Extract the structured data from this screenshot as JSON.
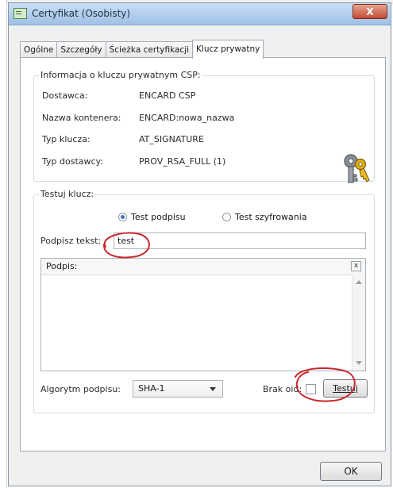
{
  "window": {
    "title": "Certyfikat (Osobisty)",
    "close_glyph": "X"
  },
  "tabs": [
    {
      "label": "Ogólne",
      "active": false
    },
    {
      "label": "Szczegóły",
      "active": false
    },
    {
      "label": "Ścieżka certyfikacji",
      "active": false
    },
    {
      "label": "Klucz prywatny",
      "active": true
    }
  ],
  "csp_info": {
    "title": "Informacja o kluczu prywatnym CSP:",
    "rows": [
      {
        "label": "Dostawca:",
        "value": "ENCARD CSP"
      },
      {
        "label": "Nazwa kontenera:",
        "value": "ENCARD:nowa_nazwa"
      },
      {
        "label": "Typ klucza:",
        "value": "AT_SIGNATURE"
      },
      {
        "label": "Typ dostawcy:",
        "value": "PROV_RSA_FULL (1)"
      }
    ],
    "icon": "keys-icon"
  },
  "test_key": {
    "title": "Testuj klucz:",
    "radio_sign": {
      "label": "Test podpisu",
      "checked": true
    },
    "radio_encrypt": {
      "label": "Test szyfrowania",
      "checked": false
    },
    "sign_text_label": "Podpisz tekst:",
    "sign_text_value": "test",
    "signature_label": "Podpis:",
    "signature_clear_glyph": "x",
    "algorithm_label": "Algorytm podpisu:",
    "algorithm_value": "SHA-1",
    "no_oid_label": "Brak oid:",
    "no_oid_checked": false,
    "test_button": "Testuj"
  },
  "footer": {
    "ok_button": "OK"
  },
  "colors": {
    "annotation": "#c8282e",
    "title_bar": "#b5d1f0",
    "close_button": "#c9573f",
    "radio_selected": "#3b6fb5"
  }
}
